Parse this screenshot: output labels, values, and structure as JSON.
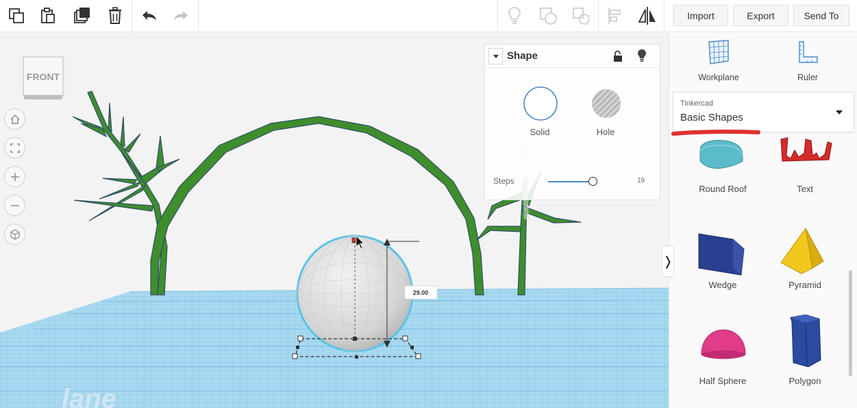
{
  "toolbar": {
    "left_tools": [
      {
        "name": "copy-icon"
      },
      {
        "name": "paste-icon"
      },
      {
        "name": "duplicate-icon"
      },
      {
        "name": "delete-icon"
      },
      {
        "name": "undo-icon"
      },
      {
        "name": "redo-icon"
      }
    ],
    "right_tools": [
      {
        "name": "lightbulb-icon"
      },
      {
        "name": "group-icon"
      },
      {
        "name": "ungroup-icon"
      },
      {
        "name": "align-icon"
      },
      {
        "name": "mirror-icon"
      }
    ],
    "import_label": "Import",
    "export_label": "Export",
    "send_to_label": "Send To"
  },
  "viewport": {
    "view_cube_label": "FRONT",
    "nav_buttons": [
      "home-icon",
      "fit-view-icon",
      "zoom-in-icon",
      "zoom-out-icon",
      "perspective-icon"
    ],
    "dimension_value": "29.00",
    "workplane_watermark": "lane",
    "colors": {
      "grid": "#7fc3e6",
      "plant": "#3f8d2c",
      "sphere": "#e0e0e0"
    }
  },
  "inspector": {
    "title": "Shape",
    "solid_label": "Solid",
    "hole_label": "Hole",
    "steps_label": "Steps",
    "steps_value": "19"
  },
  "sidebar": {
    "workplane_label": "Workplane",
    "ruler_label": "Ruler",
    "library_provider": "Tinkercad",
    "library_name": "Basic Shapes",
    "shapes": [
      {
        "label": "Round Roof",
        "color": "#5bbcc9"
      },
      {
        "label": "Text",
        "color": "#d62b2b"
      },
      {
        "label": "Wedge",
        "color": "#2a3f8f"
      },
      {
        "label": "Pyramid",
        "color": "#f2c81e"
      },
      {
        "label": "Half Sphere",
        "color": "#e13c8a"
      },
      {
        "label": "Polygon",
        "color": "#2b4aa0"
      }
    ],
    "toggle_glyph": "❭"
  }
}
